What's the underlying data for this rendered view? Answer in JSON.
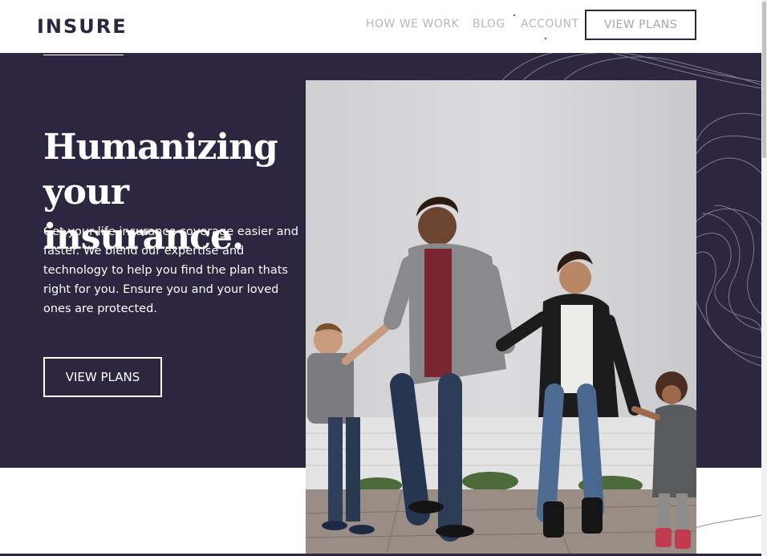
{
  "header": {
    "logo": "INSURE",
    "nav": {
      "how_we_work": "HOW WE WORK",
      "blog": "BLOG",
      "account": "ACCOUNT",
      "view_plans": "VIEW PLANS"
    }
  },
  "hero": {
    "title_line1": "Humanizing",
    "title_line2": "your insurance.",
    "description": "Get your life insurance coverage easier and faster. We blend our expertise and technology to help you find the plan thats right for you. Ensure you and your loved ones are protected.",
    "cta": "VIEW PLANS"
  },
  "colors": {
    "brand_dark": "#2c2640",
    "text_light": "#ffffff",
    "nav_muted": "#b8b5c0"
  }
}
